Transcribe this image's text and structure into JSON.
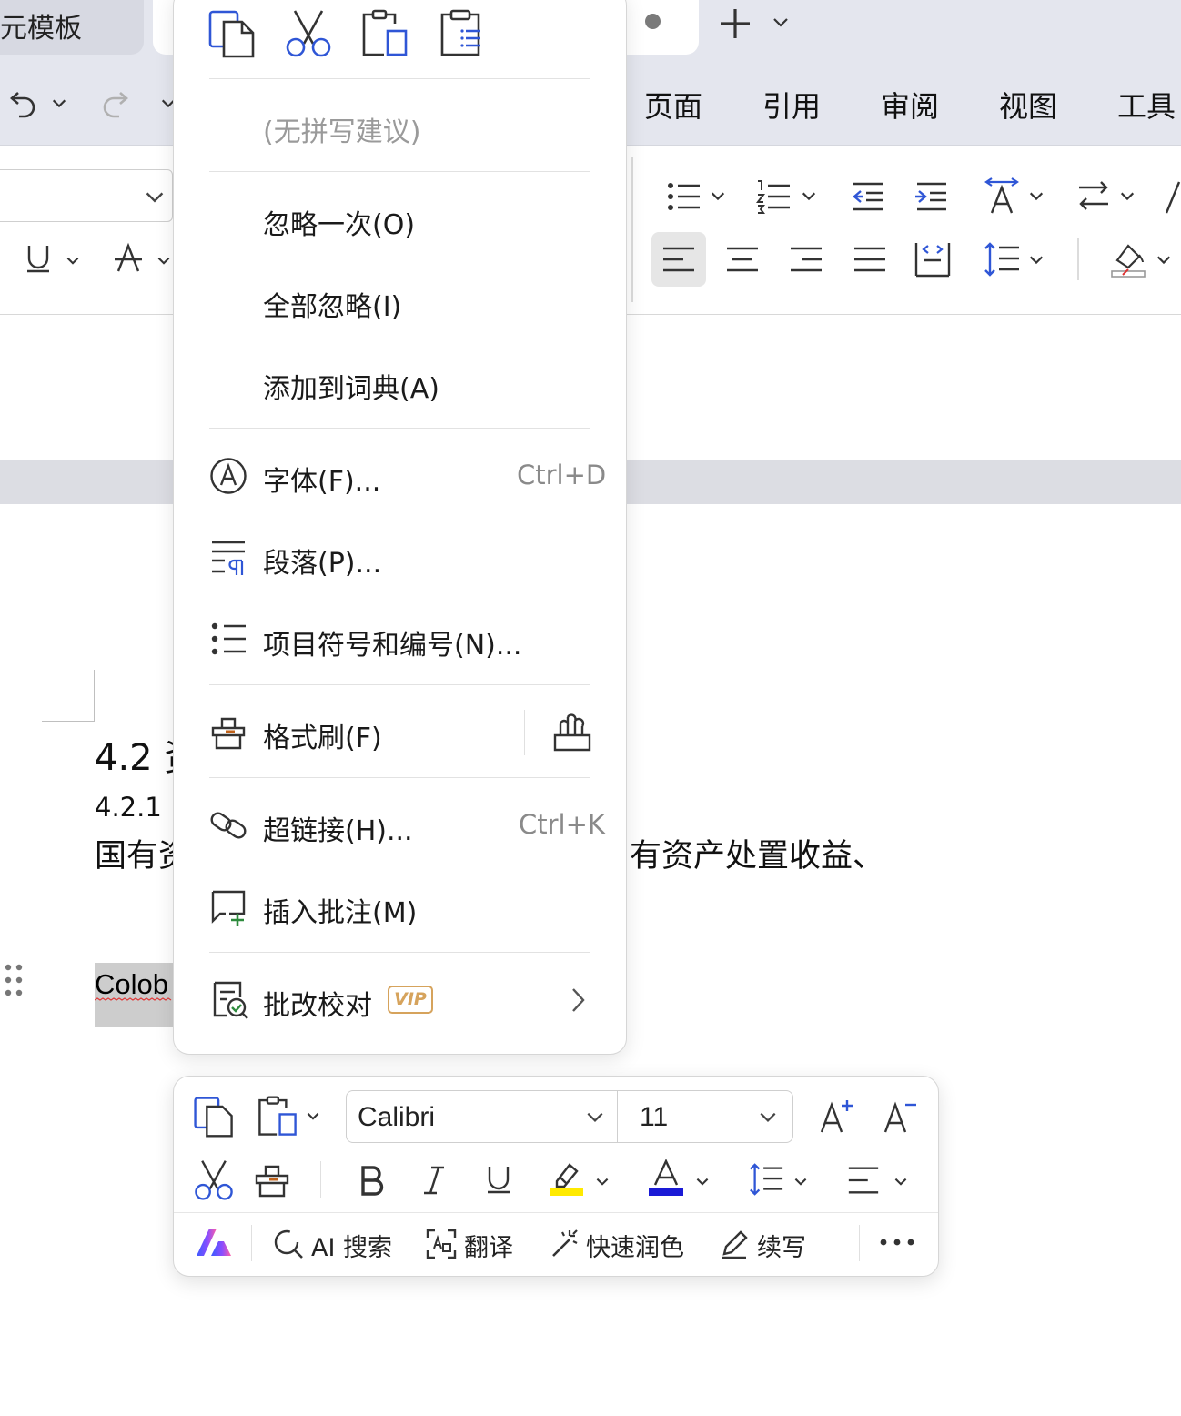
{
  "tabs": {
    "left_label": "元模板"
  },
  "menubar": {
    "items": [
      "页面",
      "引用",
      "审阅",
      "视图",
      "工具"
    ]
  },
  "document": {
    "heading2": "4.2 资",
    "heading3": "4.2.1",
    "paragraph_left": "国有资",
    "paragraph_right": "有资产处置收益、",
    "selected_text": "Colob"
  },
  "context_menu": {
    "spelling_suggestion": "(无拼写建议)",
    "ignore_once": "忽略一次(O)",
    "ignore_all": "全部忽略(I)",
    "add_to_dictionary": "添加到词典(A)",
    "font": {
      "label": "字体(F)...",
      "shortcut": "Ctrl+D"
    },
    "paragraph": {
      "label": "段落(P)..."
    },
    "bullets": {
      "label": "项目符号和编号(N)..."
    },
    "format_painter": {
      "label": "格式刷(F)"
    },
    "hyperlink": {
      "label": "超链接(H)...",
      "shortcut": "Ctrl+K"
    },
    "insert_comment": {
      "label": "插入批注(M)"
    },
    "proofread": {
      "label": "批改校对",
      "badge": "VIP"
    }
  },
  "mini_toolbar": {
    "font_name": "Calibri",
    "font_size": "11",
    "ai_search": "AI 搜索",
    "translate": "翻译",
    "polish": "快速润色",
    "continue": "续写"
  },
  "colors": {
    "accent": "#2f56d6",
    "highlight": "#ffea00",
    "font_color": "#1a1ad6",
    "vip": "#d6a35c"
  }
}
